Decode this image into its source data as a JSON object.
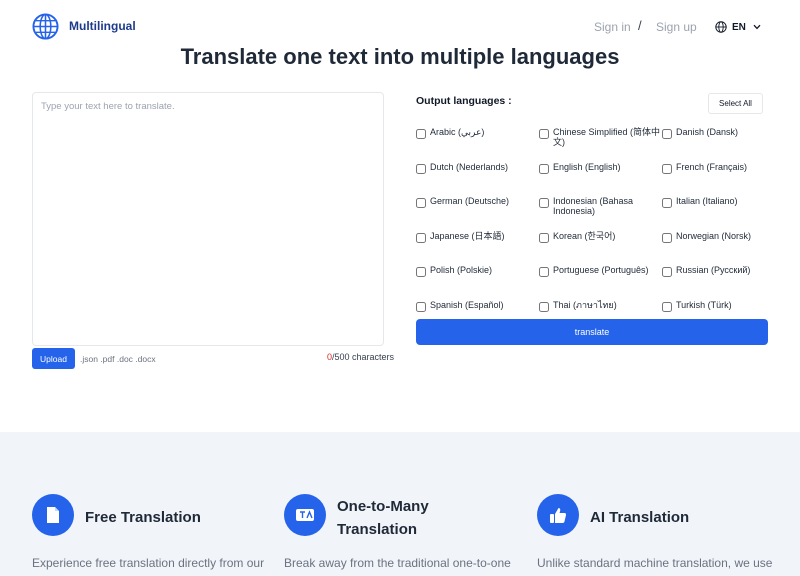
{
  "header": {
    "brand": "Multilingual",
    "sign_in": "Sign in",
    "separator": "/",
    "sign_up": "Sign up",
    "language": "EN"
  },
  "main": {
    "title": "Translate one text into multiple languages",
    "input_placeholder": "Type your text here to translate.",
    "upload_label": "Upload",
    "file_types": ".json .pdf .doc .docx",
    "char_current": "0",
    "char_max": "/500 characters",
    "output_label": "Output languages :",
    "select_all_label": "Select All",
    "languages": [
      "Arabic (عربي)",
      "Chinese Simplified (简体中文)",
      "Danish (Dansk)",
      "Dutch (Nederlands)",
      "English (English)",
      "French (Français)",
      "German (Deutsche)",
      "Indonesian (Bahasa Indonesia)",
      "Italian (Italiano)",
      "Japanese (日本語)",
      "Korean (한국어)",
      "Norwegian (Norsk)",
      "Polish (Polskie)",
      "Portuguese (Português)",
      "Russian (Русский)",
      "Spanish (Español)",
      "Thai (ภาษาไทย)",
      "Turkish (Türk)"
    ],
    "translate_label": "translate"
  },
  "features": [
    {
      "icon": "document-icon",
      "title": "Free Translation",
      "desc": "Experience free translation directly from our"
    },
    {
      "icon": "translation-icon",
      "title": "One-to-Many Translation",
      "desc": "Break away from the traditional one-to-one"
    },
    {
      "icon": "thumbs-up-icon",
      "title": "AI Translation",
      "desc": "Unlike standard machine translation, we use"
    }
  ],
  "colors": {
    "accent": "#2563eb",
    "brand": "#1e3a8a",
    "features_bg": "#f1f5f9"
  }
}
